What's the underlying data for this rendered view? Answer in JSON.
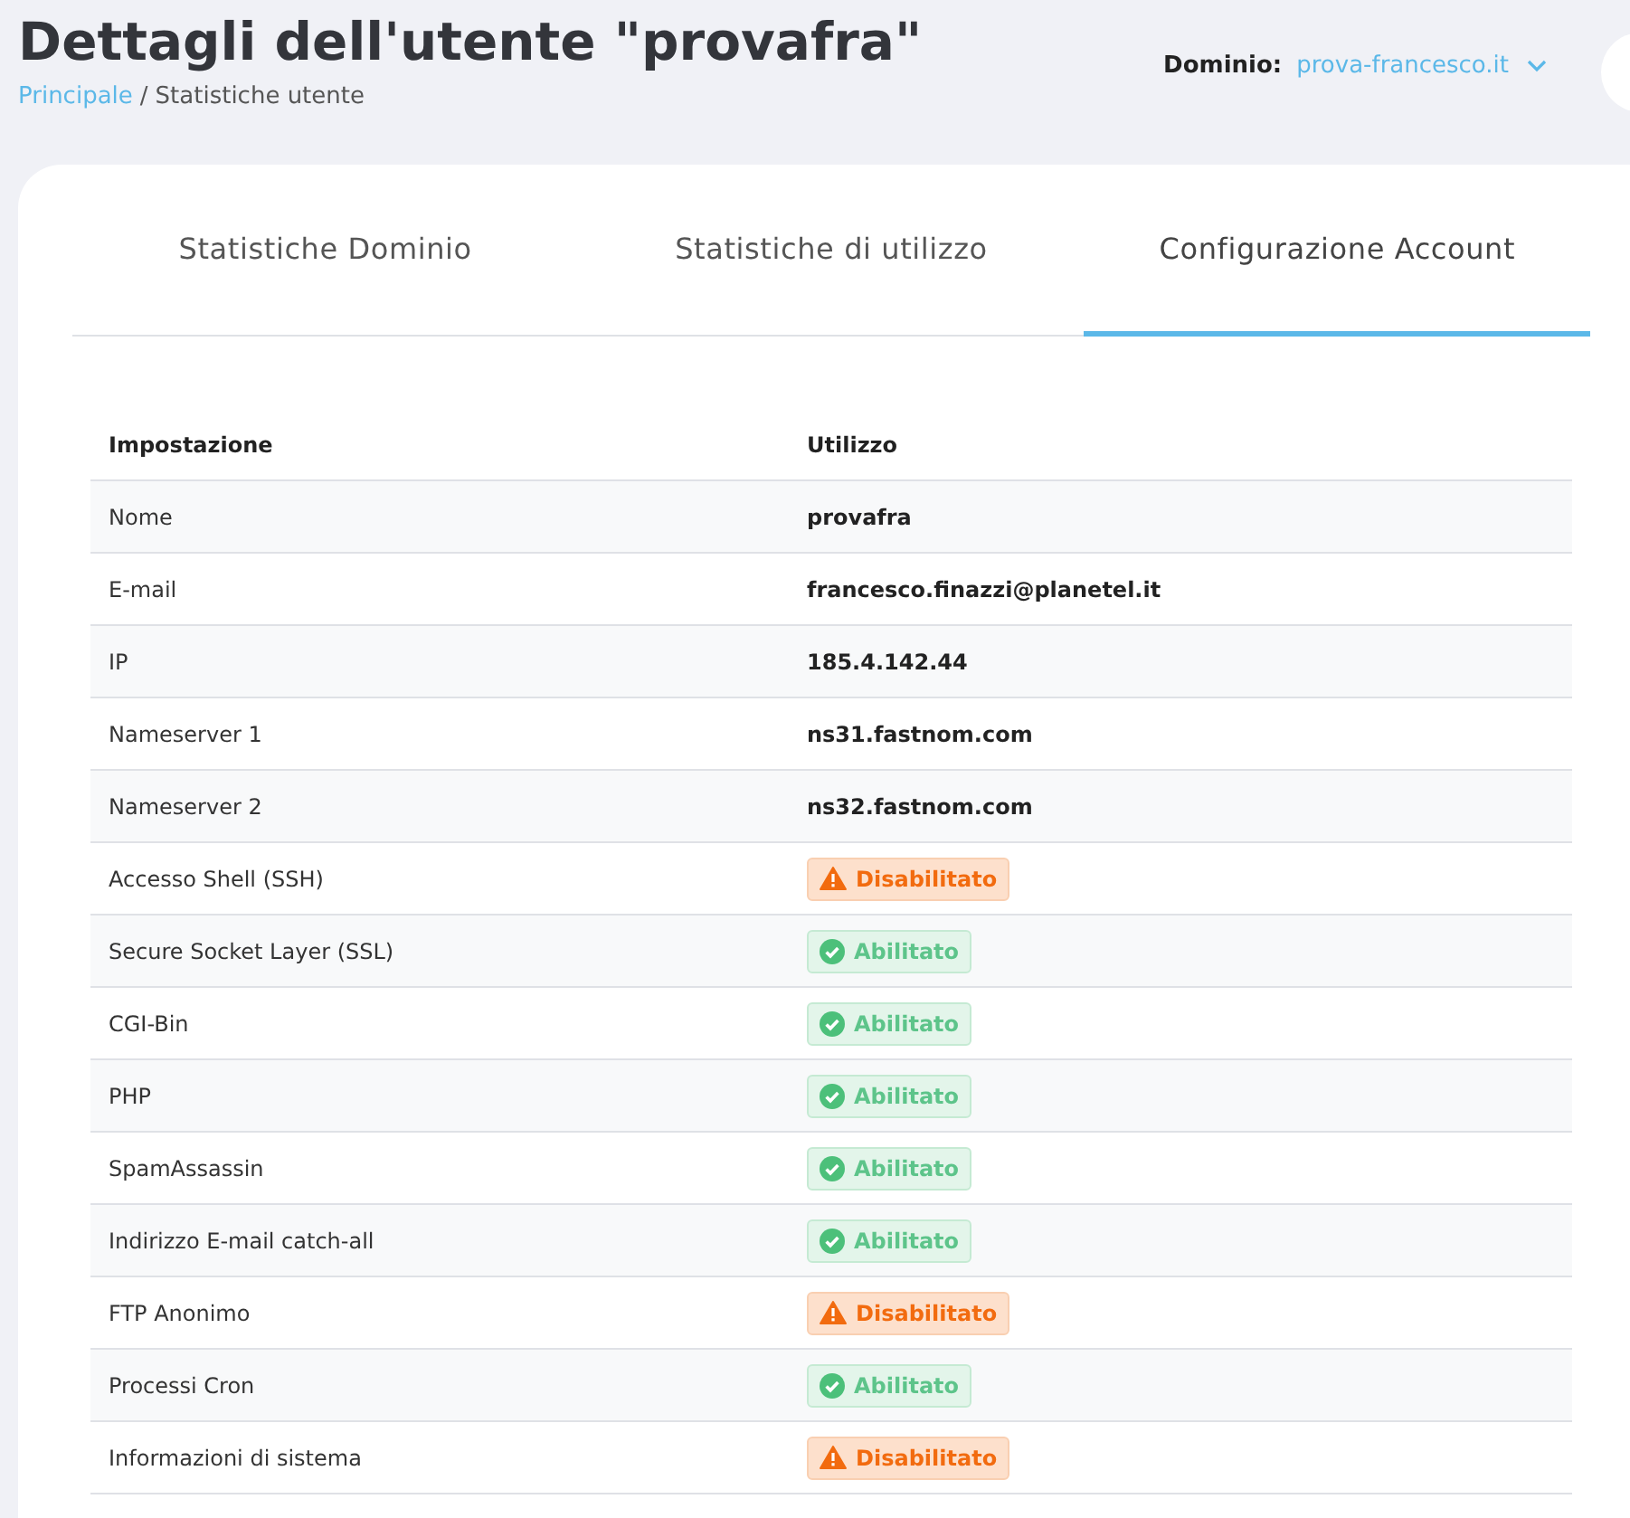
{
  "header": {
    "title": "Dettagli dell'utente \"provafra\"",
    "breadcrumb_separator": "/",
    "breadcrumb": [
      {
        "label": "Principale",
        "link": true
      },
      {
        "label": "Statistiche utente",
        "link": false
      }
    ],
    "domain_label": "Dominio:",
    "domain_value": "prova-francesco.it"
  },
  "tabs": [
    {
      "label": "Statistiche Dominio",
      "selected": false
    },
    {
      "label": "Statistiche di utilizzo",
      "selected": false
    },
    {
      "label": "Configurazione Account",
      "selected": true
    }
  ],
  "table": {
    "columns": [
      "Impostazione",
      "Utilizzo"
    ],
    "rows": [
      {
        "setting": "Nome",
        "kind": "text",
        "value": "provafra"
      },
      {
        "setting": "E-mail",
        "kind": "text",
        "value": "francesco.finazzi@planetel.it"
      },
      {
        "setting": "IP",
        "kind": "text",
        "value": "185.4.142.44"
      },
      {
        "setting": "Nameserver 1",
        "kind": "text",
        "value": "ns31.fastnom.com"
      },
      {
        "setting": "Nameserver 2",
        "kind": "text",
        "value": "ns32.fastnom.com"
      },
      {
        "setting": "Accesso Shell (SSH)",
        "kind": "status",
        "enabled": false,
        "value": "Disabilitato"
      },
      {
        "setting": "Secure Socket Layer (SSL)",
        "kind": "status",
        "enabled": true,
        "value": "Abilitato"
      },
      {
        "setting": "CGI-Bin",
        "kind": "status",
        "enabled": true,
        "value": "Abilitato"
      },
      {
        "setting": "PHP",
        "kind": "status",
        "enabled": true,
        "value": "Abilitato"
      },
      {
        "setting": "SpamAssassin",
        "kind": "status",
        "enabled": true,
        "value": "Abilitato"
      },
      {
        "setting": "Indirizzo E-mail catch-all",
        "kind": "status",
        "enabled": true,
        "value": "Abilitato"
      },
      {
        "setting": "FTP Anonimo",
        "kind": "status",
        "enabled": false,
        "value": "Disabilitato"
      },
      {
        "setting": "Processi Cron",
        "kind": "status",
        "enabled": true,
        "value": "Abilitato"
      },
      {
        "setting": "Informazioni di sistema",
        "kind": "status",
        "enabled": false,
        "value": "Disabilitato"
      }
    ]
  }
}
